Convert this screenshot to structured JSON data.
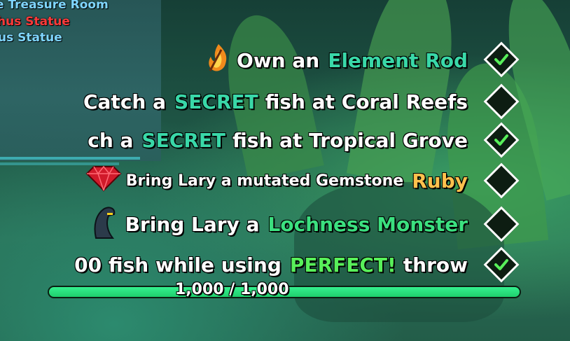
{
  "location_labels": [
    {
      "text": "e Treasure Room",
      "color": "#7fd6ff"
    },
    {
      "text": "hus Statue",
      "color": "#ff3a3a"
    },
    {
      "text": "us Statue",
      "color": "#7fd6ff"
    }
  ],
  "quests": [
    {
      "prefix": "Own an",
      "highlight": "Element Rod",
      "suffix": "",
      "highlight_color": "#3be07f",
      "icon": "flame-rod-icon",
      "completed": true
    },
    {
      "prefix": "Catch a",
      "highlight": "SECRET",
      "suffix": "fish at Coral Reefs",
      "highlight_color": "#39d8a8",
      "icon": "",
      "completed": false
    },
    {
      "prefix": "ch a",
      "highlight": "SECRET",
      "suffix": "fish at Tropical Grove",
      "highlight_color": "#39d8a8",
      "icon": "",
      "completed": true
    },
    {
      "prefix": "Bring Lary a mutated Gemstone",
      "highlight": "Ruby",
      "suffix": "",
      "highlight_color": "#ffc14d",
      "icon": "ruby-icon",
      "completed": false
    },
    {
      "prefix": "Bring Lary a",
      "highlight": "Lochness Monster",
      "suffix": "",
      "highlight_color": "#3be07f",
      "icon": "lochness-monster-icon",
      "completed": false
    },
    {
      "prefix": "00 fish while using",
      "highlight": "PERFECT!",
      "suffix": "throw",
      "highlight_color": "#58f05a",
      "icon": "",
      "completed": true
    }
  ],
  "progress": {
    "text": "1,000 / 1,000",
    "fraction": 1.0
  },
  "colors": {
    "check": "#58f05a",
    "box_fill": "#0d1d12",
    "progress_fill": "#1fcf6c"
  }
}
